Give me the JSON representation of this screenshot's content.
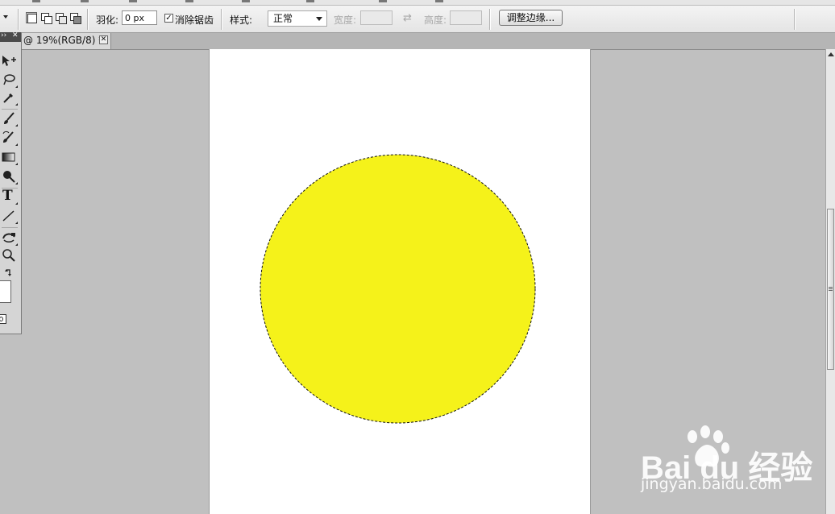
{
  "options_bar": {
    "feather_label": "羽化:",
    "feather_value": "0 px",
    "antialias_label": "消除锯齿",
    "antialias_checked": true,
    "style_label": "样式:",
    "style_value": "正常",
    "width_label": "宽度:",
    "height_label": "高度:",
    "refine_edge_label": "调整边缘..."
  },
  "document_tab": {
    "title": "@ 19%(RGB/8) *",
    "close_glyph": "✕"
  },
  "tool_panel": {
    "header_left": "››",
    "header_right": "✕",
    "type_tool_glyph": "T"
  },
  "canvas": {
    "background_color": "#ffffff",
    "circle_color": "#f5f21a",
    "selection": "elliptical marquee (marching ants)"
  },
  "watermark": {
    "brand": "Bai du 经验",
    "url": "jingyan.baidu.com"
  },
  "colors": {
    "workspace": "#c0c0c0",
    "toolbar": "#e8e8e8",
    "circle": "#f5f21a"
  }
}
